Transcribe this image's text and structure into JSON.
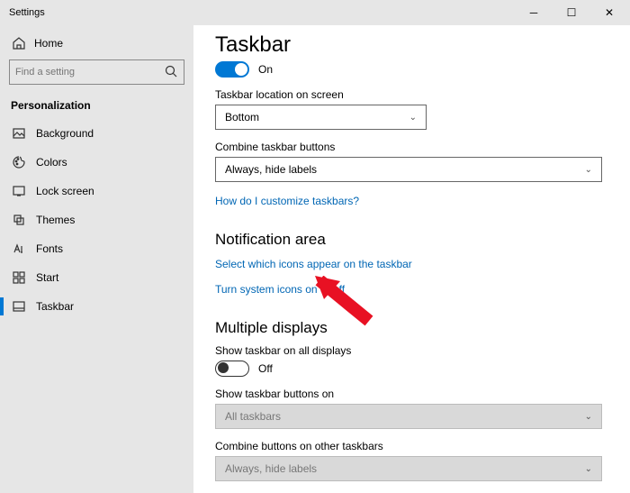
{
  "window": {
    "title": "Settings"
  },
  "sidebar": {
    "home": "Home",
    "search_placeholder": "Find a setting",
    "section": "Personalization",
    "items": [
      {
        "label": "Background"
      },
      {
        "label": "Colors"
      },
      {
        "label": "Lock screen"
      },
      {
        "label": "Themes"
      },
      {
        "label": "Fonts"
      },
      {
        "label": "Start"
      },
      {
        "label": "Taskbar"
      }
    ]
  },
  "page": {
    "title": "Taskbar",
    "toggle_on_label": "On",
    "loc_label": "Taskbar location on screen",
    "loc_value": "Bottom",
    "combine_label": "Combine taskbar buttons",
    "combine_value": "Always, hide labels",
    "customize_link": "How do I customize taskbars?",
    "notif_heading": "Notification area",
    "select_icons_link": "Select which icons appear on the taskbar",
    "system_icons_link": "Turn system icons on or off",
    "multi_heading": "Multiple displays",
    "show_all_label": "Show taskbar on all displays",
    "toggle_off_label": "Off",
    "show_buttons_label": "Show taskbar buttons on",
    "show_buttons_value": "All taskbars",
    "combine_other_label": "Combine buttons on other taskbars",
    "combine_other_value": "Always, hide labels"
  }
}
